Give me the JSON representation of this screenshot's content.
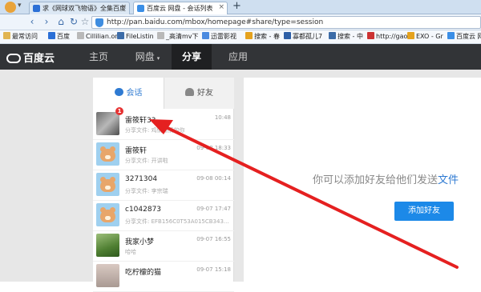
{
  "browser": {
    "tabs": [
      {
        "title": "求《网球双飞物语》全集百度",
        "close": "×"
      },
      {
        "title": "百度云 网盘 - 会话列表",
        "close": "×"
      }
    ],
    "new_tab": "+",
    "url": "http://pan.baidu.com/mbox/homepage#share/type=session",
    "bookmarks": [
      "最常访问",
      "百度",
      "Cillilian.or",
      "FileListin",
      "_高清mv下",
      "迅雷影视",
      "搜索 - 春",
      "寡都孤儿7",
      "搜索 - 中",
      "http://gao",
      "EXO - Gr",
      "百度云 网"
    ]
  },
  "header": {
    "logo": "百度云",
    "nav": [
      "主页",
      "网盘",
      "分享",
      "应用"
    ],
    "active": "分享"
  },
  "panel": {
    "tabs": [
      "会话",
      "好友"
    ],
    "conversations": [
      {
        "name": "雷筱轩33",
        "time": "10:48",
        "sub": "分享文件: 鸡情燃情的你",
        "badge": "1"
      },
      {
        "name": "雷筱轩",
        "time": "09-08 18:33",
        "sub": "分享文件: 开讲啦"
      },
      {
        "name": "3271304",
        "time": "09-08 00:14",
        "sub": "分享文件: 李宗瑞"
      },
      {
        "name": "c1042873",
        "time": "09-07 17:47",
        "sub": "分享文件: EFB156C0T53A015CB343..."
      },
      {
        "name": "我家小梦",
        "time": "09-07 16:55",
        "sub": "哈哈"
      },
      {
        "name": "吃柠檬的猫",
        "time": "09-07 15:18",
        "sub": ""
      }
    ]
  },
  "main": {
    "prompt": "你可以添加好友给他们发送",
    "prompt_highlight": "文件",
    "add_button": "添加好友"
  },
  "colors": {
    "accent": "#1c89e8",
    "header_bg": "#323437",
    "arrow": "#e52020"
  }
}
